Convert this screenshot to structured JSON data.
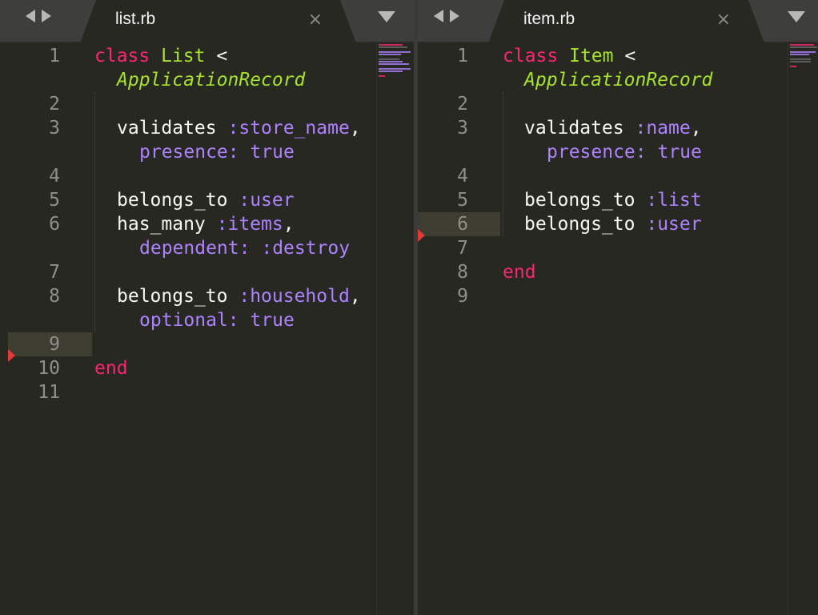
{
  "colors": {
    "background": "#272822",
    "keyword": "#f92672",
    "class_name": "#a6e22e",
    "symbol": "#ae81ff",
    "text": "#f8f8f2",
    "line_number": "#90908a",
    "marker": "#e13a37"
  },
  "icons": {
    "nav_back": "arrow-left-icon",
    "nav_forward": "arrow-right-icon",
    "close": "close-icon",
    "menu": "chevron-down-icon",
    "marker": "marker-icon"
  },
  "left": {
    "tab": {
      "label": "list.rb",
      "close": "×"
    },
    "highlighted_line": 9,
    "marker_line": 9,
    "code": {
      "l1_kw": "class",
      "l1_class": "List",
      "l1_op": " <",
      "l1_super": "ApplicationRecord",
      "l3_method": "validates",
      "l3_sym": ":store_name",
      "l3_comma": ",",
      "l3_key": "presence:",
      "l3_val": "true",
      "l5_method": "belongs_to",
      "l5_sym": ":user",
      "l6_method": "has_many",
      "l6_sym": ":items",
      "l6_comma": ",",
      "l6_key": "dependent:",
      "l6_val": ":destroy",
      "l8_method": "belongs_to",
      "l8_sym": ":household",
      "l8_comma": ",",
      "l8_key": "optional:",
      "l8_val": "true",
      "l10_kw": "end"
    },
    "line_numbers": [
      "1",
      "2",
      "3",
      "4",
      "5",
      "6",
      "7",
      "8",
      "9",
      "10",
      "11"
    ]
  },
  "right": {
    "tab": {
      "label": "item.rb",
      "close": "×"
    },
    "highlighted_line": 6,
    "marker_line": 6,
    "code": {
      "l1_kw": "class",
      "l1_class": "Item",
      "l1_op": " <",
      "l1_super": "ApplicationRecord",
      "l3_method": "validates",
      "l3_sym": ":name",
      "l3_comma": ",",
      "l3_key": "presence:",
      "l3_val": "true",
      "l5_method": "belongs_to",
      "l5_sym": ":list",
      "l6_method": "belongs_to",
      "l6_sym": ":user",
      "l8_kw": "end"
    },
    "line_numbers": [
      "1",
      "2",
      "3",
      "4",
      "5",
      "6",
      "7",
      "8",
      "9"
    ]
  }
}
